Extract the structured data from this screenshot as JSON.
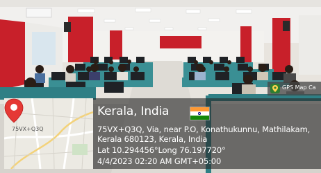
{
  "photo": {
    "subject": "computer lab with students at desks",
    "colors": {
      "wall_red": "#c8202a",
      "wall_white": "#ecebe8",
      "cabinet_teal": "#3a8f94",
      "floor": "#d6d3cd"
    }
  },
  "overlay": {
    "place": "Kerala, India",
    "address_line1": "75VX+Q3Q, Via, near P.O, Konathukunnu, Mathilakam,",
    "address_line2": "Kerala 680123, Kerala, India",
    "coords": "Lat 10.294456°Long 76.197720°",
    "datetime": "4/4/2023 02:20 AM GMT+05:00",
    "map_code": "75VX+Q3Q",
    "flag_icon": "india-flag-icon",
    "pin_icon": "map-pin-icon",
    "colors": {
      "panel": "#282828",
      "pin": "#e53935",
      "text": "#ffffff"
    }
  },
  "badge": {
    "label": "GPS Map Ca",
    "icon": "gps-map-camera-icon"
  }
}
